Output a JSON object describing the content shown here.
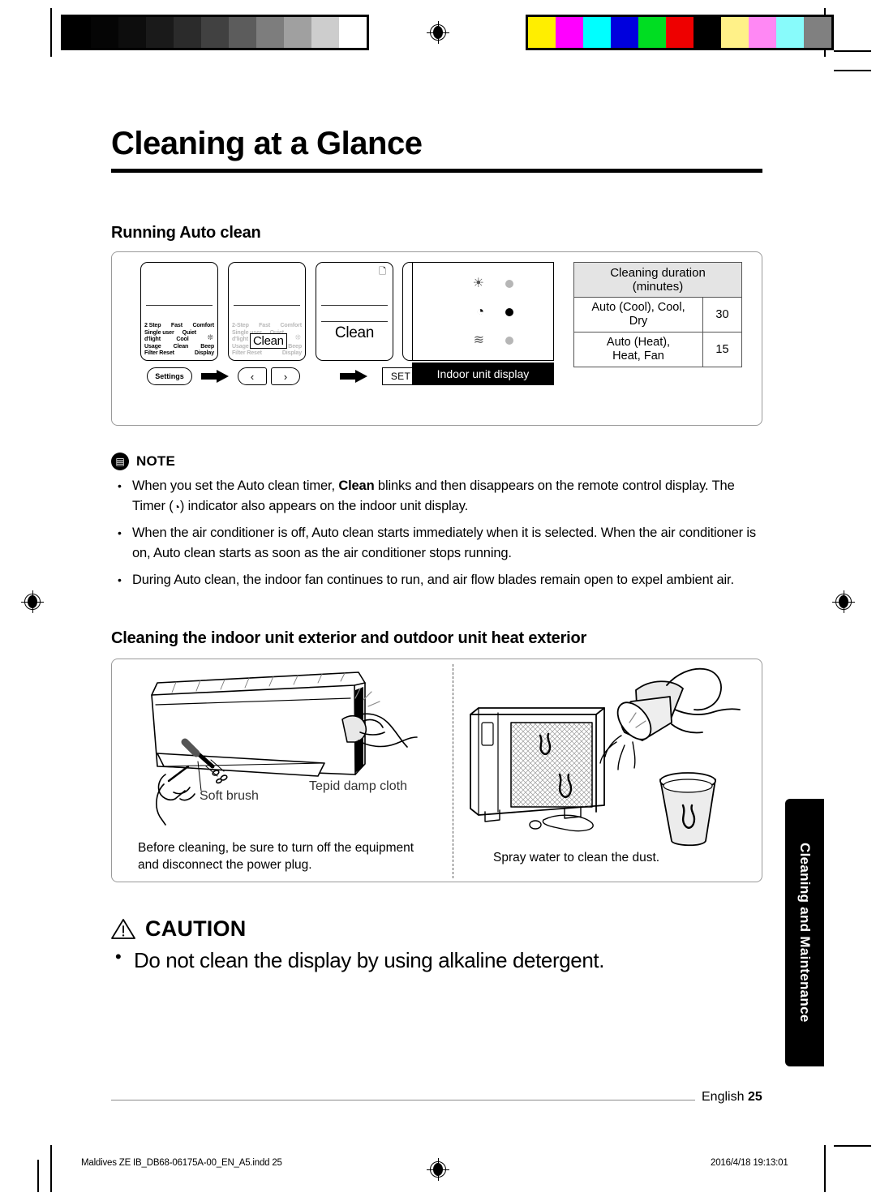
{
  "document": {
    "title": "Cleaning at a Glance",
    "section_running": "Running Auto clean",
    "section_exterior": "Cleaning the indoor unit exterior and outdoor unit heat exterior"
  },
  "calibration": {
    "grayscale": [
      "#000000",
      "#050505",
      "#0d0d0d",
      "#1a1a1a",
      "#2b2b2b",
      "#414141",
      "#5c5c5c",
      "#7d7d7d",
      "#a0a0a0",
      "#cdcdcd",
      "#ffffff"
    ],
    "colors": [
      "#ffee00",
      "#ff00ff",
      "#00ffff",
      "#0000dd",
      "#00dd22",
      "#ee0000",
      "#000000",
      "#fff188",
      "#ff88f4",
      "#88fbfb",
      "#808080"
    ]
  },
  "remote_steps": {
    "screen_labels": [
      [
        "2 Step",
        "Fast",
        "Comfort"
      ],
      [
        "Single user",
        "Quiet",
        ""
      ],
      [
        "d'light",
        "Cool",
        ""
      ],
      [
        "Usage",
        "Clean",
        "Beep"
      ],
      [
        "Filter Reset",
        "",
        "Display"
      ]
    ],
    "screen_labels_step2": [
      [
        "2-Step",
        "Fast",
        "Comfort"
      ],
      [
        "Single user",
        "Quiet",
        ""
      ],
      [
        "d'light",
        "",
        ""
      ],
      [
        "Usage",
        "",
        "Beep"
      ],
      [
        "Filter Reset",
        "",
        "Display"
      ]
    ],
    "clean_badge": "Clean",
    "clean_selected": "Clean",
    "battery_icon": "battery-icon",
    "settings_button": "Settings",
    "prev_button": "‹",
    "next_button": "›",
    "set_button": "SET",
    "arrow_icon": "arrow-right-icon"
  },
  "indoor_display": {
    "caption": "Indoor unit display",
    "indicators": [
      {
        "icon": "clean-sparkle-icon",
        "glyph": "☀",
        "state": "off"
      },
      {
        "icon": "timer-clock-icon",
        "glyph": "◔",
        "state": "on"
      },
      {
        "icon": "airflow-wave-icon",
        "glyph": "≋",
        "state": "off"
      }
    ]
  },
  "duration_table": {
    "header": "Cleaning duration (minutes)",
    "header_line1": "Cleaning duration",
    "header_line2": "(minutes)",
    "rows": [
      {
        "mode": "Auto (Cool), Cool, Dry",
        "mode_line1": "Auto (Cool), Cool,",
        "mode_line2": "Dry",
        "minutes": "30"
      },
      {
        "mode": "Auto (Heat), Heat, Fan",
        "mode_line1": "Auto (Heat),",
        "mode_line2": "Heat, Fan",
        "minutes": "15"
      }
    ]
  },
  "note": {
    "icon": "note-document-icon",
    "title": "NOTE",
    "items": [
      {
        "part1": "When you set the Auto clean timer, ",
        "bold": "Clean",
        "part2": " blinks and then disappears on the remote control display. The Timer (",
        "glyph": "timer-clock-icon",
        "part3": ") indicator also appears on the indoor unit display."
      },
      {
        "text": "When the air conditioner is off, Auto clean starts immediately when it is selected. When the air conditioner is on, Auto clean starts as soon as the air conditioner stops running."
      },
      {
        "text": "During Auto clean, the indoor fan continues to run, and air flow blades remain open to expel ambient air."
      }
    ]
  },
  "exterior": {
    "label_soft_brush": "Soft brush",
    "label_tepid_cloth": "Tepid damp cloth",
    "caption_left": "Before cleaning, be sure to turn off the equipment and disconnect the power plug.",
    "caption_right": "Spray water to clean the dust."
  },
  "caution": {
    "icon": "warning-triangle-icon",
    "title": "CAUTION",
    "text": "Do not clean the display by using alkaline detergent."
  },
  "side_tab": {
    "label": "Cleaning and Maintenance"
  },
  "footer": {
    "language": "English",
    "page_number": "25",
    "imprint_file": "Maldives ZE IB_DB68-06175A-00_EN_A5.indd   25",
    "imprint_timestamp": "2016/4/18   19:13:01"
  }
}
